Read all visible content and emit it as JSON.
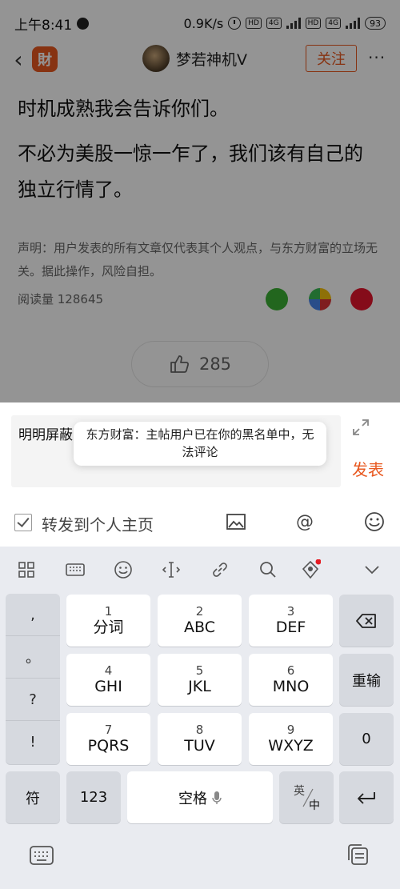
{
  "status": {
    "time": "上午8:41",
    "speed": "0.9K/s",
    "hd1": "HD",
    "net1": "4G",
    "hd2": "HD",
    "net2": "4G",
    "battery": "93"
  },
  "nav": {
    "author": "梦若神机V",
    "follow_label": "关注",
    "more": "···"
  },
  "article": {
    "paragraphs": [
      "时机成熟我会告诉你们。",
      "不必为美股一惊一乍了，我们该有自己的",
      "独立行情了。"
    ],
    "disclaimer": "声明：用户发表的所有文章仅代表其个人观点，与东方财富的立场无关。据此操作，风险自担。",
    "reads": "阅读量 128645",
    "likes": "285"
  },
  "comment": {
    "draft": "明明屏蔽",
    "publish_label": "发表",
    "repost_label": "转发到个人主页"
  },
  "toast": {
    "message": "东方财富：主帖用户已在你的黑名单中，无法评论"
  },
  "keyboard": {
    "punct": [
      ",",
      "。",
      "?",
      "!"
    ],
    "keys": [
      {
        "num": "1",
        "let": "分词"
      },
      {
        "num": "2",
        "let": "ABC"
      },
      {
        "num": "3",
        "let": "DEF"
      },
      {
        "num": "4",
        "let": "GHI"
      },
      {
        "num": "5",
        "let": "JKL"
      },
      {
        "num": "6",
        "let": "MNO"
      },
      {
        "num": "7",
        "let": "PQRS"
      },
      {
        "num": "8",
        "let": "TUV"
      },
      {
        "num": "9",
        "let": "WXYZ"
      }
    ],
    "reinput": "重输",
    "zero": "0",
    "symbol": "符",
    "numbers": "123",
    "space": "空格",
    "lang_top": "英",
    "lang_bottom": "中"
  },
  "colors": {
    "brand": "#e8581f"
  },
  "icons": [
    "back-icon",
    "app-logo",
    "more-icon",
    "wechat-icon",
    "moments-icon",
    "weibo-icon",
    "thumb-up-icon",
    "expand-icon",
    "image-icon",
    "mention-icon",
    "emoji-icon",
    "grid-icon",
    "keyboard-icon",
    "cursor-icon",
    "link-icon",
    "search-icon",
    "voice-badge-icon",
    "collapse-icon",
    "backspace-icon",
    "mic-icon",
    "enter-icon",
    "clipboard-icon"
  ]
}
